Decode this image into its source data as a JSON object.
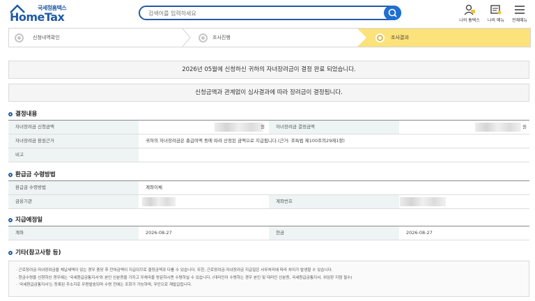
{
  "header": {
    "logo_top": "국세청홈택스",
    "logo_main": "HomeTax",
    "search_placeholder": "검색어를 입력하세요",
    "icons": [
      {
        "name": "lock-user-icon",
        "label": "나의 홈택스"
      },
      {
        "name": "my-menu-icon",
        "label": "나의 메뉴"
      },
      {
        "name": "menu-icon",
        "label": "전체메뉴"
      }
    ]
  },
  "steps": [
    {
      "label": "신청내역확인",
      "active": false
    },
    {
      "label": "조사진행",
      "active": false
    },
    {
      "label": "조사결과",
      "active": true
    }
  ],
  "notices": {
    "first": "2026년 05월에 신청하신 귀하의 자녀장려금이 결정 완료 되었습니다.",
    "second": "신청금액과 관계없이 심사결과에 따라 장려금이 결정됩니다."
  },
  "decision": {
    "title": "결정내용",
    "applied_label": "자녀장려금 신청금액",
    "applied_unit": "원",
    "decided_label": "자녀장려금 결정금액",
    "decided_unit": "원",
    "basis_label": "자녀장려금 환원근거",
    "basis_value": "귀하의 자녀장려금은 총급여액 등에 따라 산정된 금액으로 지급됩니다.(근거: 조특법 제100조의29제1항)",
    "note_label": "비고",
    "note_value": ""
  },
  "refund": {
    "title": "환급금 수령방법",
    "method_label": "환급금 수령방법",
    "method_value": "계좌이체",
    "bank_label": "금융기관",
    "account_label": "계좌번호"
  },
  "schedule": {
    "title": "지급예정일",
    "first_label": "계좌",
    "first_date": "2026-08-27",
    "second_label": "현금",
    "second_date": "2026-08-27"
  },
  "etc": {
    "title": "기타(참고사항 등)",
    "lines": [
      "· 근로장려금·자녀장려금을 체납세액이 있는 경우 충당 후 잔여금액이 지급되므로 결정금액과 다를 수 있습니다. 또한, 근로장려금·자녀장려금 지급일은 사무처리에 따라 차이가 발생할 수 있습니다.",
      "· 현금수령을 신청하신 경우에는 '국세환급금통지서'와 본인 신분증을 가지고 우체국을 방문하시면 수령하실 수 있습니다. (대리인이 수령하는 경우 본인 및 대리인 신분증, 국세환급금통지서, 위임장 지참 필수)",
      "· '국세환급금통지서'는 등록된 주소지로 우편발송되며 수령 전에는 조회가 가능하며, 무단으로 재발급됩니다."
    ]
  },
  "colors": {
    "brand": "#1f5aa6",
    "active_step": "#fbe27a",
    "header_cell": "#eef4f4"
  }
}
